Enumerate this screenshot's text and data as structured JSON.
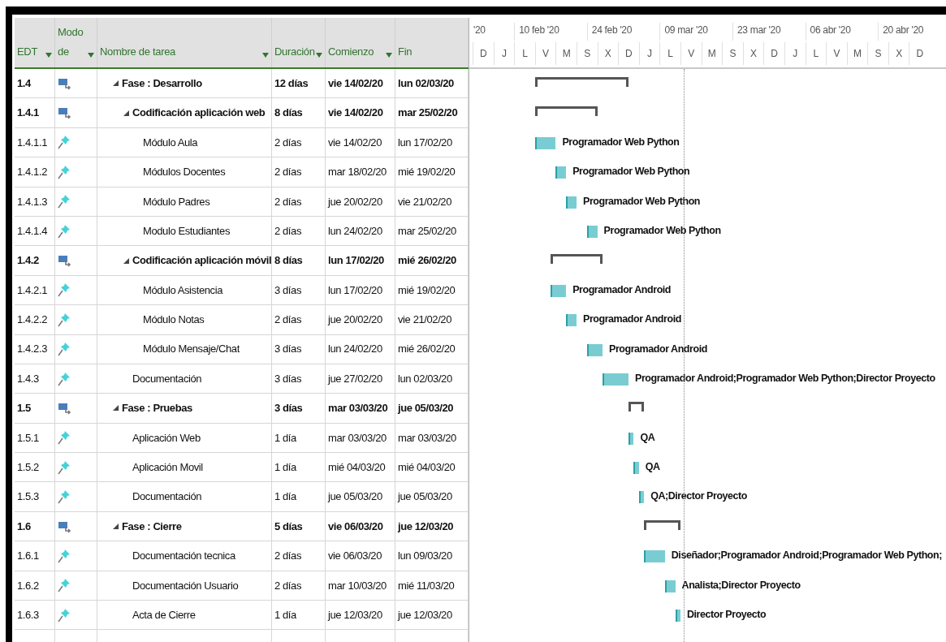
{
  "table": {
    "columns": [
      {
        "label": "EDT",
        "dropdown": true
      },
      {
        "label": "Modo de",
        "dropdown": true
      },
      {
        "label": "Nombre de tarea",
        "dropdown": true
      },
      {
        "label": "Duración",
        "dropdown": true
      },
      {
        "label": "Comienzo",
        "dropdown": true
      },
      {
        "label": "Fin",
        "dropdown": false
      }
    ],
    "rows": [
      {
        "kind": "summary",
        "expanded": true,
        "wbs": "1.4",
        "name": "Fase : Desarrollo",
        "duration": "12 días",
        "start": "vie 14/02/20",
        "finish": "lun 02/03/20",
        "children": [
          {
            "kind": "summary",
            "expanded": true,
            "wbs": "1.4.1",
            "name": "Codificación aplicación web",
            "duration": "8 días",
            "start": "vie 14/02/20",
            "finish": "mar 25/02/20",
            "children": [
              {
                "kind": "task",
                "wbs": "1.4.1.1",
                "name": "Módulo Aula",
                "duration": "2 días",
                "start": "vie 14/02/20",
                "finish": "lun 17/02/20",
                "resources": "Programador Web Python"
              },
              {
                "kind": "task",
                "wbs": "1.4.1.2",
                "name": "Módulos Docentes",
                "duration": "2 días",
                "start": "mar 18/02/20",
                "finish": "mié 19/02/20",
                "resources": "Programador Web Python"
              },
              {
                "kind": "task",
                "wbs": "1.4.1.3",
                "name": "Módulo Padres",
                "duration": "2 días",
                "start": "jue 20/02/20",
                "finish": "vie 21/02/20",
                "resources": "Programador Web Python"
              },
              {
                "kind": "task",
                "wbs": "1.4.1.4",
                "name": "Modulo Estudiantes",
                "duration": "2 días",
                "start": "lun 24/02/20",
                "finish": "mar 25/02/20",
                "resources": "Programador Web Python"
              }
            ]
          },
          {
            "kind": "summary",
            "expanded": true,
            "wbs": "1.4.2",
            "name": "Codificación aplicación móvil",
            "duration": "8 días",
            "start": "lun 17/02/20",
            "finish": "mié 26/02/20",
            "children": [
              {
                "kind": "task",
                "wbs": "1.4.2.1",
                "name": "Módulo Asistencia",
                "duration": "3 días",
                "start": "lun 17/02/20",
                "finish": "mié 19/02/20",
                "resources": "Programador Android"
              },
              {
                "kind": "task",
                "wbs": "1.4.2.2",
                "name": "Módulo Notas",
                "duration": "2 días",
                "start": "jue 20/02/20",
                "finish": "vie 21/02/20",
                "resources": "Programador Android"
              },
              {
                "kind": "task",
                "wbs": "1.4.2.3",
                "name": "Módulo Mensaje/Chat",
                "duration": "3 días",
                "start": "lun 24/02/20",
                "finish": "mié 26/02/20",
                "resources": "Programador Android"
              }
            ]
          },
          {
            "kind": "task",
            "wbs": "1.4.3",
            "name": "Documentación",
            "duration": "3 días",
            "start": "jue 27/02/20",
            "finish": "lun 02/03/20",
            "resources": "Programador Android;Programador Web Python;Director Proyecto"
          }
        ]
      },
      {
        "kind": "summary",
        "expanded": true,
        "wbs": "1.5",
        "name": "Fase : Pruebas",
        "duration": "3 días",
        "start": "mar 03/03/20",
        "finish": "jue 05/03/20",
        "children": [
          {
            "kind": "task",
            "wbs": "1.5.1",
            "name": "Aplicación Web",
            "duration": "1 día",
            "start": "mar 03/03/20",
            "finish": "mar 03/03/20",
            "resources": "QA"
          },
          {
            "kind": "task",
            "wbs": "1.5.2",
            "name": "Aplicación Movil",
            "duration": "1 día",
            "start": "mié 04/03/20",
            "finish": "mié 04/03/20",
            "resources": "QA"
          },
          {
            "kind": "task",
            "wbs": "1.5.3",
            "name": "Documentación",
            "duration": "1 día",
            "start": "jue 05/03/20",
            "finish": "jue 05/03/20",
            "resources": "QA;Director Proyecto"
          }
        ]
      },
      {
        "kind": "summary",
        "expanded": true,
        "wbs": "1.6",
        "name": "Fase : Cierre",
        "duration": "5 días",
        "start": "vie 06/03/20",
        "finish": "jue 12/03/20",
        "children": [
          {
            "kind": "task",
            "wbs": "1.6.1",
            "name": "Documentación tecnica",
            "duration": "2 días",
            "start": "vie 06/03/20",
            "finish": "lun 09/03/20",
            "resources": "Diseñador;Programador Android;Programador Web Python;"
          },
          {
            "kind": "task",
            "wbs": "1.6.2",
            "name": "Documentación Usuario",
            "duration": "2 días",
            "start": "mar 10/03/20",
            "finish": "mié 11/03/20",
            "resources": "Analista;Director Proyecto"
          },
          {
            "kind": "task",
            "wbs": "1.6.3",
            "name": "Acta de Cierre",
            "duration": "1 día",
            "start": "jue 12/03/20",
            "finish": "jue 12/03/20",
            "resources": "Director Proyecto"
          }
        ]
      }
    ]
  },
  "timescale": {
    "top": [
      "'20",
      "10 feb '20",
      "24 feb '20",
      "09 mar '20",
      "23 mar '20",
      "06 abr '20",
      "20 abr '20"
    ],
    "bottom": [
      "D",
      "J",
      "L",
      "V",
      "M",
      "S",
      "X",
      "D",
      "J",
      "L",
      "V",
      "M",
      "S",
      "X",
      "D",
      "J",
      "L",
      "V",
      "M",
      "S",
      "X",
      "D"
    ]
  }
}
